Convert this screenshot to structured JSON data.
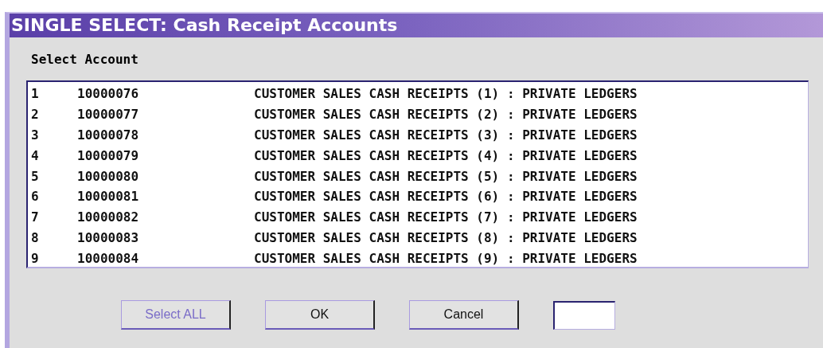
{
  "window": {
    "title": "SINGLE SELECT: Cash Receipt Accounts"
  },
  "label": "Select Account",
  "rows": [
    {
      "index": "1",
      "account": "10000076",
      "description": "CUSTOMER SALES CASH RECEIPTS (1) : PRIVATE LEDGERS"
    },
    {
      "index": "2",
      "account": "10000077",
      "description": "CUSTOMER SALES CASH RECEIPTS (2) : PRIVATE LEDGERS"
    },
    {
      "index": "3",
      "account": "10000078",
      "description": "CUSTOMER SALES CASH RECEIPTS (3) : PRIVATE LEDGERS"
    },
    {
      "index": "4",
      "account": "10000079",
      "description": "CUSTOMER SALES CASH RECEIPTS (4) : PRIVATE LEDGERS"
    },
    {
      "index": "5",
      "account": "10000080",
      "description": "CUSTOMER SALES CASH RECEIPTS (5) : PRIVATE LEDGERS"
    },
    {
      "index": "6",
      "account": "10000081",
      "description": "CUSTOMER SALES CASH RECEIPTS (6) : PRIVATE LEDGERS"
    },
    {
      "index": "7",
      "account": "10000082",
      "description": "CUSTOMER SALES CASH RECEIPTS (7) : PRIVATE LEDGERS"
    },
    {
      "index": "8",
      "account": "10000083",
      "description": "CUSTOMER SALES CASH RECEIPTS (8) : PRIVATE LEDGERS"
    },
    {
      "index": "9",
      "account": "10000084",
      "description": "CUSTOMER SALES CASH RECEIPTS (9) : PRIVATE LEDGERS"
    }
  ],
  "buttons": [
    {
      "label": "Select ALL",
      "disabled": true
    },
    {
      "label": "OK",
      "disabled": false
    },
    {
      "label": "Cancel",
      "disabled": false
    }
  ]
}
